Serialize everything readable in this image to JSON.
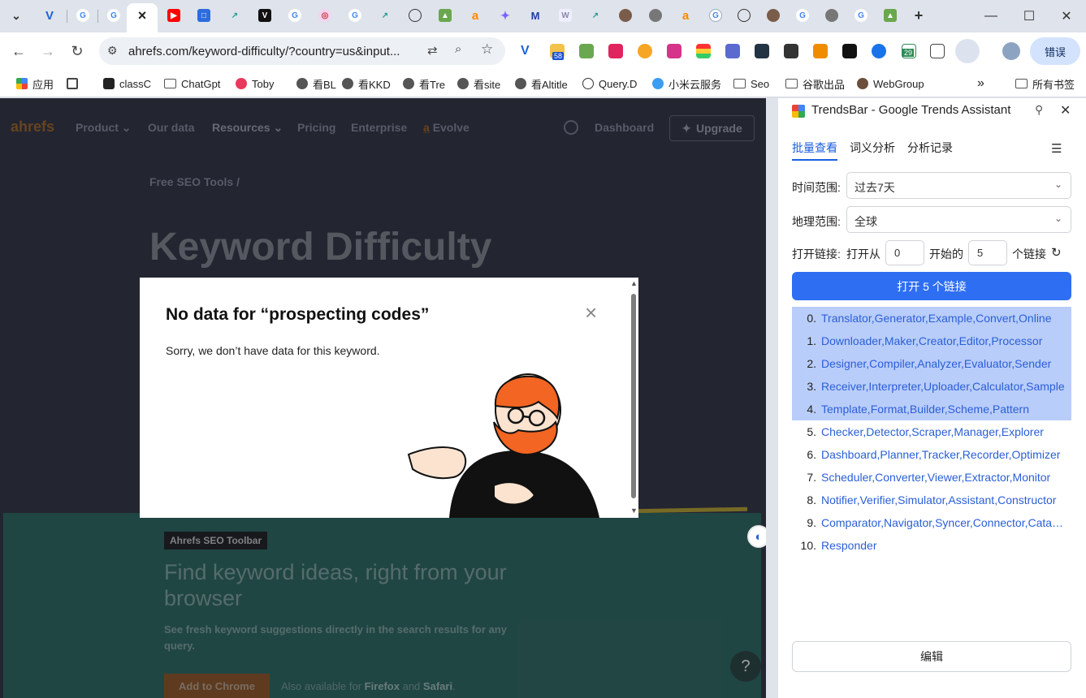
{
  "browser": {
    "address_url": "ahrefs.com/keyword-difficulty/?country=us&input...",
    "profile_label": "错误",
    "ext_badges": [
      "58",
      "29"
    ]
  },
  "bookmarks": [
    {
      "label": "应用",
      "icon": "apps-grid-icon"
    },
    {
      "label": "classC",
      "icon": "site-icon"
    },
    {
      "label": "ChatGpt",
      "icon": "folder-icon"
    },
    {
      "label": "Toby",
      "icon": "toby-icon"
    },
    {
      "label": "看BL",
      "icon": "globe-icon"
    },
    {
      "label": "看KKD",
      "icon": "globe-icon"
    },
    {
      "label": "看Tre",
      "icon": "globe-icon"
    },
    {
      "label": "看site",
      "icon": "globe-icon"
    },
    {
      "label": "看Altitle",
      "icon": "globe-icon"
    },
    {
      "label": "Query.D",
      "icon": "circle-icon"
    },
    {
      "label": "小米云服务",
      "icon": "cloud-icon"
    },
    {
      "label": "Seo",
      "icon": "folder-icon"
    },
    {
      "label": "谷歌出品",
      "icon": "folder-icon"
    },
    {
      "label": "WebGroup",
      "icon": "site-icon"
    }
  ],
  "bookmarks_more": "»",
  "bookmarks_all": "所有书签",
  "site": {
    "logo": "ahrefs",
    "nav": [
      "Product",
      "Our data",
      "Resources",
      "Pricing",
      "Enterprise",
      "Evolve"
    ],
    "dashboard": "Dashboard",
    "upgrade": "Upgrade",
    "breadcrumb": "Free SEO Tools /",
    "hero_title": "Keyword Difficulty Checker",
    "toolbar_badge": "Ahrefs SEO Toolbar",
    "toolbar_heading": "Find keyword ideas, right from your browser",
    "toolbar_desc": "See fresh keyword suggestions directly in the search results for any query.",
    "add_button": "Add to Chrome",
    "also_prefix": "Also available for",
    "also_firefox": "Firefox",
    "also_and": "and",
    "also_safari": "Safari",
    "also_dot": ".",
    "help": "?"
  },
  "modal": {
    "title": "No data for “prospecting codes”",
    "body": "Sorry, we don’t have data for this keyword.",
    "close": "×"
  },
  "panel": {
    "title": "TrendsBar - Google Trends Assistant",
    "tabs": [
      "批量查看",
      "词义分析",
      "分析记录"
    ],
    "time_label": "时间范围:",
    "time_value": "过去7天",
    "geo_label": "地理范围:",
    "geo_value": "全球",
    "open_label": "打开链接:",
    "open_from": "打开从",
    "from_value": "0",
    "start_of": "开始的",
    "count_value": "5",
    "links_unit": "个链接",
    "open_button": "打开 5 个链接",
    "items": [
      {
        "idx": "0.",
        "text": "Translator,Generator,Example,Convert,Online",
        "selected": true
      },
      {
        "idx": "1.",
        "text": "Downloader,Maker,Creator,Editor,Processor",
        "selected": true
      },
      {
        "idx": "2.",
        "text": "Designer,Compiler,Analyzer,Evaluator,Sender",
        "selected": true
      },
      {
        "idx": "3.",
        "text": "Receiver,Interpreter,Uploader,Calculator,Sample",
        "selected": true
      },
      {
        "idx": "4.",
        "text": "Template,Format,Builder,Scheme,Pattern",
        "selected": true
      },
      {
        "idx": "5.",
        "text": "Checker,Detector,Scraper,Manager,Explorer",
        "selected": false
      },
      {
        "idx": "6.",
        "text": "Dashboard,Planner,Tracker,Recorder,Optimizer",
        "selected": false
      },
      {
        "idx": "7.",
        "text": "Scheduler,Converter,Viewer,Extractor,Monitor",
        "selected": false
      },
      {
        "idx": "8.",
        "text": "Notifier,Verifier,Simulator,Assistant,Constructor",
        "selected": false
      },
      {
        "idx": "9.",
        "text": "Comparator,Navigator,Syncer,Connector,Catalo...",
        "selected": false
      },
      {
        "idx": "10.",
        "text": "Responder",
        "selected": false
      }
    ],
    "edit_button": "编辑"
  },
  "colors": {
    "accent": "#2e6ef2",
    "selected_row": "#b9cdfa",
    "ahrefs_orange": "#ff8800",
    "green_section": "#1b5d52"
  }
}
